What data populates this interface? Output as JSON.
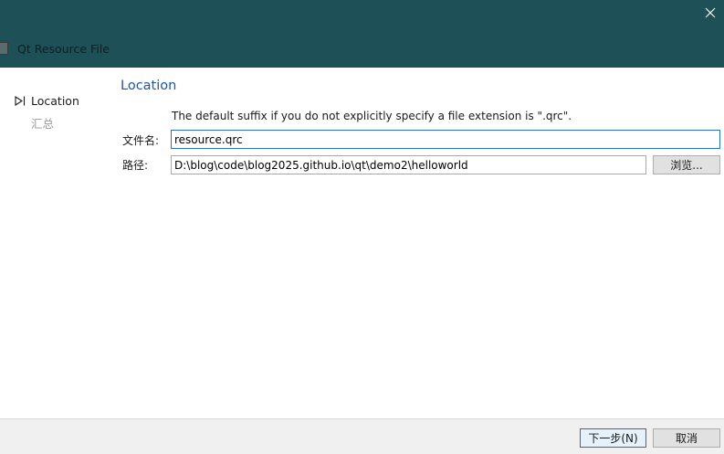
{
  "window": {
    "title": "Qt Resource File",
    "close_icon": "close-icon",
    "titlebar_color": "#1e5058"
  },
  "sidebar": {
    "steps": [
      {
        "label": "Location",
        "current": true,
        "marker_icon": "current-step-triangle-icon"
      },
      {
        "label": "汇总",
        "current": false
      }
    ]
  },
  "page": {
    "title": "Location",
    "title_color": "#1c55a8",
    "hint": "The default suffix if you do not explicitly specify a file extension is \".qrc\".",
    "fields": {
      "name_label": "文件名:",
      "name_value": "resource.qrc",
      "path_label": "路径:",
      "path_value": "D:\\blog\\code\\blog2025.github.io\\qt\\demo2\\helloworld",
      "browse_label": "浏览..."
    }
  },
  "footer": {
    "next_label": "下一步(N)",
    "cancel_label": "取消"
  }
}
